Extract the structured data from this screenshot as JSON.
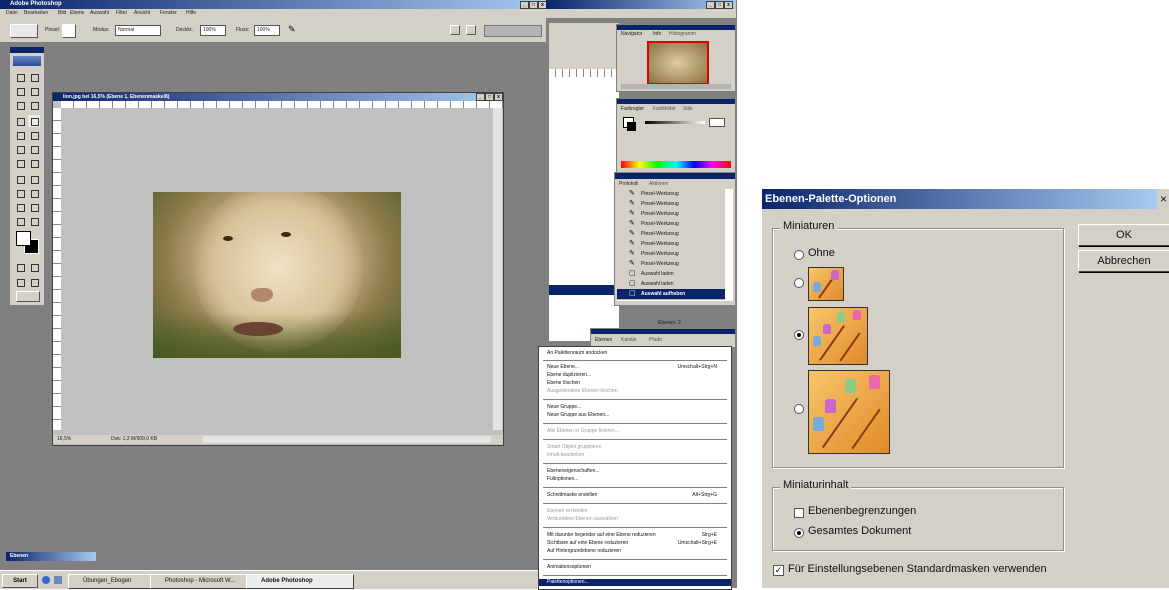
{
  "photoshop": {
    "app_title": "Adobe Photoshop",
    "menu": [
      "Datei",
      "Bearbeiten",
      "Bild",
      "Ebene",
      "Auswahl",
      "Filter",
      "Ansicht",
      "Fenster",
      "Hilfe"
    ],
    "options": {
      "modus_label": "Modus:",
      "modus_value": "Normal",
      "deckkraft_label": "Deckkr.:",
      "deckkraft_value": "100%",
      "fluss_label": "Fluss:",
      "fluss_value": "100%",
      "pinsel_label": "Pinsel:"
    },
    "document": {
      "title": "lion.jpg bei 16,5% (Ebene 1, Ebenenmaske/8)",
      "zoom": "16,5%",
      "status": "Dok: 1,2 M/909,0 KB"
    },
    "navigator": {
      "tab1": "Navigator",
      "tab2": "Info",
      "tab3": "Histogramm"
    },
    "color": {
      "tab1": "Farbregler",
      "tab2": "Farbfelder",
      "tab3": "Stile"
    },
    "history": {
      "tab1": "Protokoll",
      "tab2": "Aktionen",
      "items": [
        "Pinsel-Werkzeug",
        "Pinsel-Werkzeug",
        "Pinsel-Werkzeug",
        "Pinsel-Werkzeug",
        "Pinsel-Werkzeug",
        "Pinsel-Werkzeug",
        "Pinsel-Werkzeug",
        "Pinsel-Werkzeug",
        "Auswahl laden",
        "Auswahl laden",
        "Auswahl aufheben"
      ]
    },
    "layers_panel": {
      "tab1": "Ebenen",
      "tab2": "Kanäle",
      "tab3": "Pfade"
    },
    "layer_menu": {
      "items": [
        {
          "label": "An Palettenraum andocken",
          "shortcut": "",
          "disabled": false
        },
        {
          "label": "Neue Ebene...",
          "shortcut": "Umschalt+Strg+N",
          "disabled": false
        },
        {
          "label": "Ebene duplizieren...",
          "shortcut": "",
          "disabled": false
        },
        {
          "label": "Ebene löschen",
          "shortcut": "",
          "disabled": false
        },
        {
          "label": "Ausgeblendete Ebenen löschen",
          "shortcut": "",
          "disabled": true
        },
        {
          "label": "Neue Gruppe...",
          "shortcut": "",
          "disabled": false
        },
        {
          "label": "Neue Gruppe aus Ebenen...",
          "shortcut": "",
          "disabled": false
        },
        {
          "label": "Alle Ebenen in Gruppe fixieren...",
          "shortcut": "",
          "disabled": true
        },
        {
          "label": "Smart Objekt gruppieren",
          "shortcut": "",
          "disabled": true
        },
        {
          "label": "Inhalt bearbeiten",
          "shortcut": "",
          "disabled": true
        },
        {
          "label": "Ebeneneigenschaften...",
          "shortcut": "",
          "disabled": false
        },
        {
          "label": "Fülloptionen...",
          "shortcut": "",
          "disabled": false
        },
        {
          "label": "Schnittmaske erstellen",
          "shortcut": "Alt+Strg+G",
          "disabled": false
        },
        {
          "label": "Ebenen verbinden",
          "shortcut": "",
          "disabled": true
        },
        {
          "label": "Verbundene Ebenen auswählen",
          "shortcut": "",
          "disabled": true
        },
        {
          "label": "Mit darunter liegender auf eine Ebene reduzieren",
          "shortcut": "Strg+E",
          "disabled": false
        },
        {
          "label": "Sichtbare auf eine Ebene reduzieren",
          "shortcut": "Umschalt+Strg+E",
          "disabled": false
        },
        {
          "label": "Auf Hintergrundebene reduzieren",
          "shortcut": "",
          "disabled": false
        },
        {
          "label": "Animationsoptionen",
          "shortcut": "",
          "disabled": false
        },
        {
          "label": "Palettenoptionen...",
          "shortcut": "",
          "disabled": false
        }
      ]
    },
    "panel_status": "Ebenen: 2",
    "taskbar": {
      "start": "Start",
      "items": [
        "Übungen_Ebogen",
        "Photoshop - Microsoft W...",
        "Adobe Photoshop"
      ],
      "collapsed_window": "Ebenen"
    }
  },
  "dialog": {
    "title": "Ebenen-Palette-Optionen",
    "close": "×",
    "ok": "OK",
    "cancel": "Abbrechen",
    "thumbnails_group": "Miniaturen",
    "thumbnail_options": [
      {
        "label": "Ohne",
        "mnemonic_index": 0,
        "selected": false
      },
      {
        "label": "",
        "size": "small",
        "selected": false
      },
      {
        "label": "",
        "size": "medium",
        "selected": true
      },
      {
        "label": "",
        "size": "large",
        "selected": false
      }
    ],
    "content_group": "Miniaturinhalt",
    "content_options": [
      {
        "label": "Ebenenbegrenzungen",
        "selected": false
      },
      {
        "label": "Gesamtes Dokument",
        "selected": true
      }
    ],
    "checkbox_label": "Für Einstellungsebenen Standardmasken verwenden",
    "checkbox_checked": true
  },
  "colors": {
    "workspace": "#808080",
    "titlebar": "#0a246a",
    "selection": "#0a246a",
    "dialog_bg": "#d4d0c8"
  }
}
